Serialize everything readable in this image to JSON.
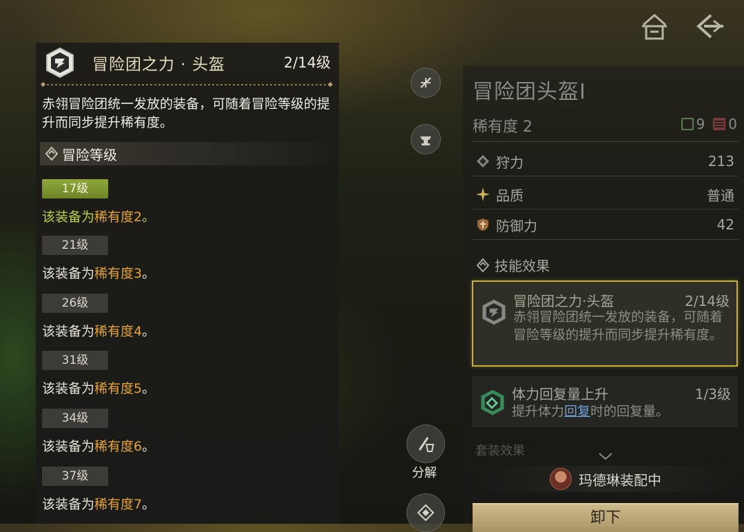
{
  "detail": {
    "title": "冒险团之力 · 头盔",
    "level": "2/14级",
    "description": "赤翎冒险团统一发放的装备，可随着冒险等级的提升而同步提升稀有度。",
    "section_label": "冒险等级",
    "tiers": [
      {
        "badge": "17级",
        "prefix": "该装备为",
        "rarity": "稀有度2",
        "suffix": "。",
        "active": true
      },
      {
        "badge": "21级",
        "prefix": "该装备为",
        "rarity": "稀有度3",
        "suffix": "。",
        "active": false
      },
      {
        "badge": "26级",
        "prefix": "该装备为",
        "rarity": "稀有度4",
        "suffix": "。",
        "active": false
      },
      {
        "badge": "31级",
        "prefix": "该装备为",
        "rarity": "稀有度5",
        "suffix": "。",
        "active": false
      },
      {
        "badge": "34级",
        "prefix": "该装备为",
        "rarity": "稀有度6",
        "suffix": "。",
        "active": false
      },
      {
        "badge": "37级",
        "prefix": "该装备为",
        "rarity": "稀有度7",
        "suffix": "。",
        "active": false
      }
    ]
  },
  "middle": {
    "decompose_label": "分解"
  },
  "item": {
    "name": "冒险团头盔Ⅰ",
    "rarity": "稀有度 2",
    "slot_green": "9",
    "slot_red": "0",
    "stats": [
      {
        "label": "狩力",
        "value": "213"
      },
      {
        "label": "品质",
        "value": "普通"
      },
      {
        "label": "防御力",
        "value": "42"
      }
    ],
    "skills_header": "技能效果",
    "skills": [
      {
        "name": "冒险团之力·头盔",
        "level": "2/14级",
        "desc": "赤翎冒险团统一发放的装备，可随着冒险等级的提升而同步提升稀有度。"
      },
      {
        "name": "体力回复量上升",
        "level": "1/3级",
        "desc_prefix": "提升体力",
        "desc_link": "回复",
        "desc_suffix": "时的回复量。"
      }
    ],
    "faded_label": "套装效果",
    "equipped_by": "玛德琳装配中",
    "unequip_label": "卸下"
  },
  "colors": {
    "accent_gold": "#c8b13a",
    "active_green": "#b9d34a",
    "rarity_orange": "#e7a33a",
    "link_blue": "#6fa0d8"
  }
}
